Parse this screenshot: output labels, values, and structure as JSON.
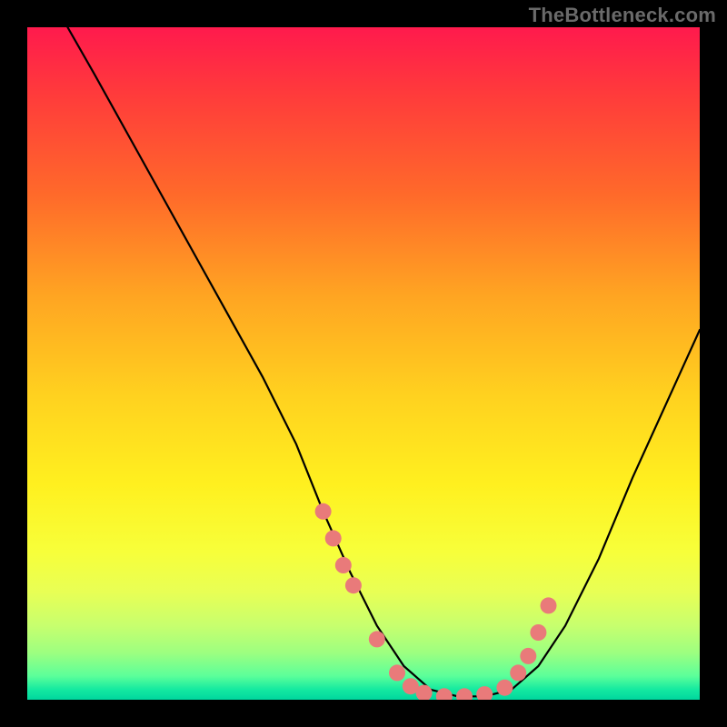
{
  "watermark": "TheBottleneck.com",
  "chart_data": {
    "type": "line",
    "title": "",
    "xlabel": "",
    "ylabel": "",
    "xlim": [
      0,
      100
    ],
    "ylim": [
      0,
      100
    ],
    "series": [
      {
        "name": "curve",
        "x": [
          6,
          10,
          15,
          20,
          25,
          30,
          35,
          40,
          44,
          48,
          52,
          56,
          60,
          64,
          68,
          72,
          76,
          80,
          85,
          90,
          95,
          100
        ],
        "values": [
          100,
          93,
          84,
          75,
          66,
          57,
          48,
          38,
          28,
          19,
          11,
          5,
          1.5,
          0.5,
          0.5,
          1.5,
          5,
          11,
          21,
          33,
          44,
          55
        ]
      }
    ],
    "markers": {
      "name": "dots",
      "color": "#e97a7a",
      "radius_px": 9,
      "x": [
        44,
        45.5,
        47,
        48.5,
        52,
        55,
        57,
        59,
        62,
        65,
        68,
        71,
        73,
        74.5,
        76,
        77.5
      ],
      "values": [
        28,
        24,
        20,
        17,
        9,
        4,
        2,
        1,
        0.5,
        0.5,
        0.8,
        1.8,
        4,
        6.5,
        10,
        14
      ]
    }
  }
}
